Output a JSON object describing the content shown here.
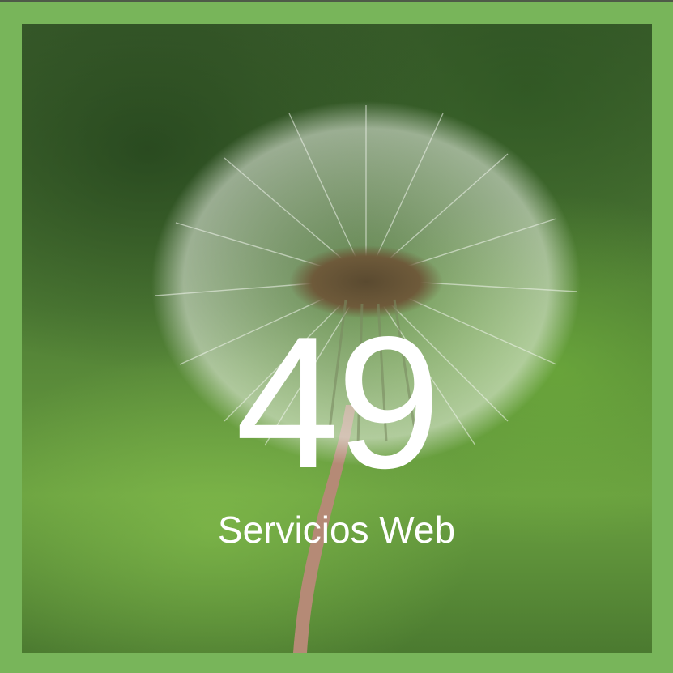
{
  "stat": {
    "value": "49",
    "label": "Servicios Web"
  },
  "colors": {
    "frame": "#78b55a",
    "text": "#ffffff"
  },
  "image": {
    "subject": "dandelion-seed-head-photo"
  }
}
